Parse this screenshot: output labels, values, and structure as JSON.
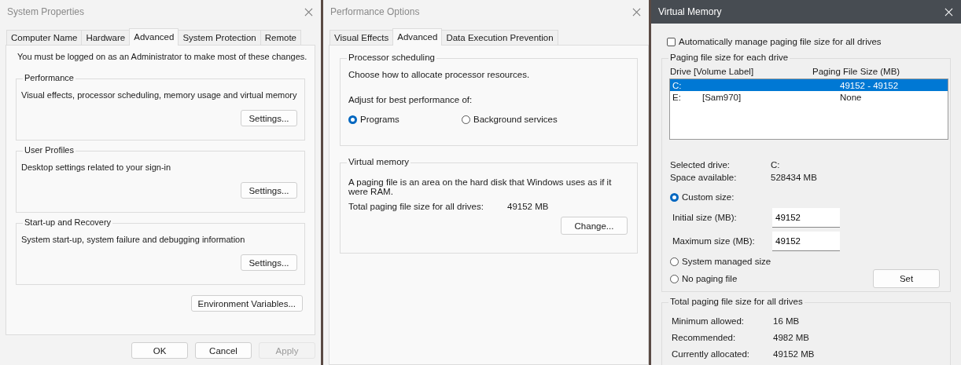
{
  "system_properties": {
    "title": "System Properties",
    "tabs": [
      {
        "label": "Computer Name",
        "selected": false
      },
      {
        "label": "Hardware",
        "selected": false
      },
      {
        "label": "Advanced",
        "selected": true
      },
      {
        "label": "System Protection",
        "selected": false
      },
      {
        "label": "Remote",
        "selected": false
      }
    ],
    "notice": "You must be logged on as an Administrator to make most of these changes.",
    "groups": [
      {
        "title": "Performance",
        "description": "Visual effects, processor scheduling, memory usage and virtual memory",
        "button": "Settings..."
      },
      {
        "title": "User Profiles",
        "description": "Desktop settings related to your sign-in",
        "button": "Settings..."
      },
      {
        "title": "Start-up and Recovery",
        "description": "System start-up, system failure and debugging information",
        "button": "Settings..."
      }
    ],
    "env_button": "Environment Variables...",
    "buttons": [
      {
        "label": "OK",
        "disabled": false
      },
      {
        "label": "Cancel",
        "disabled": false
      },
      {
        "label": "Apply",
        "disabled": true
      }
    ]
  },
  "performance_options": {
    "title": "Performance Options",
    "tabs": [
      {
        "label": "Visual Effects",
        "selected": false
      },
      {
        "label": "Advanced",
        "selected": true
      },
      {
        "label": "Data Execution Prevention",
        "selected": false
      }
    ],
    "processor_scheduling": {
      "title": "Processor scheduling",
      "description": "Choose how to allocate processor resources.",
      "adjust_label": "Adjust for best performance of:",
      "options": [
        {
          "label": "Programs",
          "selected": true
        },
        {
          "label": "Background services",
          "selected": false
        }
      ]
    },
    "virtual_memory": {
      "title": "Virtual memory",
      "description": "A paging file is an area on the hard disk that Windows uses as if it were RAM.",
      "total_label": "Total paging file size for all drives:",
      "total_value": "49152 MB",
      "button": "Change..."
    }
  },
  "virtual_memory": {
    "title": "Virtual Memory",
    "auto_manage": {
      "label": "Automatically manage paging file size for all drives",
      "checked": false
    },
    "drive_group": {
      "title": "Paging file size for each drive",
      "columns": [
        "Drive  [Volume Label]",
        "Paging File Size (MB)"
      ],
      "drives": [
        {
          "drive": "C:",
          "size": "49152 - 49152",
          "selected": true
        },
        {
          "drive": "E:",
          "label": "[Sam970]",
          "size": "None",
          "selected": false
        }
      ],
      "info": [
        {
          "label": "Selected drive:",
          "value": "C:"
        },
        {
          "label": "Space available:",
          "value": "528434 MB"
        }
      ],
      "size_options": [
        {
          "kind": "custom",
          "label": "Custom size:",
          "selected": true,
          "fields": [
            {
              "label": "Initial size (MB):",
              "value": "49152"
            },
            {
              "label": "Maximum size (MB):",
              "value": "49152"
            }
          ]
        },
        {
          "kind": "plain",
          "label": "System managed size",
          "selected": false
        },
        {
          "kind": "plain",
          "label": "No paging file",
          "selected": false
        }
      ],
      "set_button": "Set"
    },
    "totals": {
      "title": "Total paging file size for all drives",
      "rows": [
        {
          "label": "Minimum allowed:",
          "value": "16 MB"
        },
        {
          "label": "Recommended:",
          "value": "4982 MB"
        },
        {
          "label": "Currently allocated:",
          "value": "49152 MB"
        }
      ]
    }
  }
}
